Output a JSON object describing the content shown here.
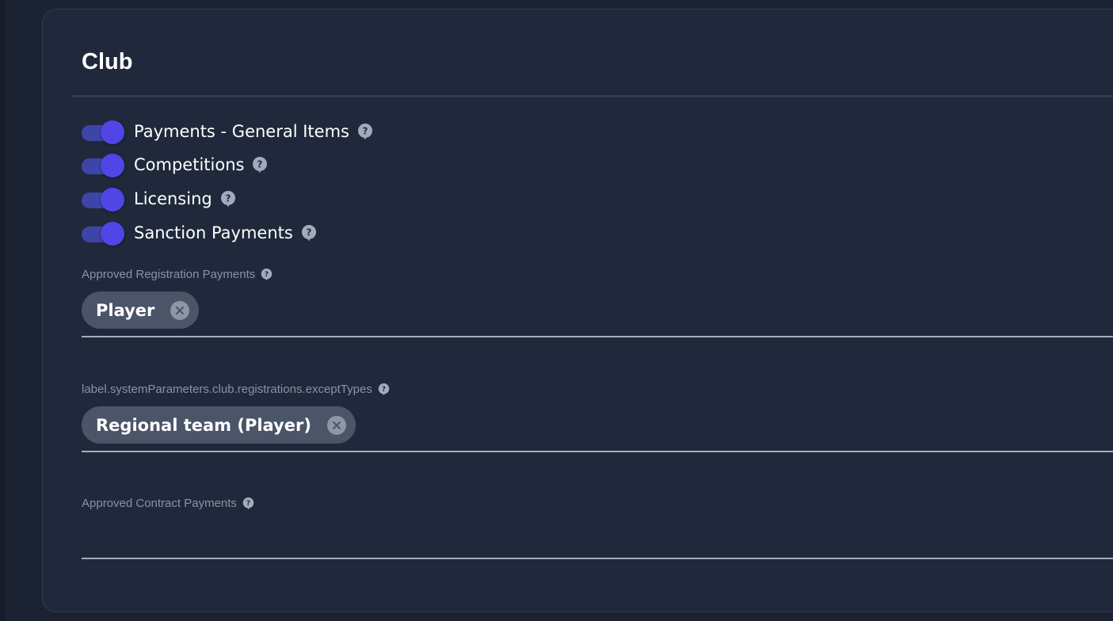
{
  "section": {
    "title": "Club"
  },
  "switches": [
    {
      "label": "Payments - General Items",
      "checked": true
    },
    {
      "label": "Competitions",
      "checked": true
    },
    {
      "label": "Licensing",
      "checked": true
    },
    {
      "label": "Sanction Payments",
      "checked": true
    }
  ],
  "fields": {
    "approved_registration_payments": {
      "label": "Approved Registration Payments",
      "chips": [
        "Player"
      ]
    },
    "except_types": {
      "label": "label.systemParameters.club.registrations.exceptTypes",
      "chips": [
        "Regional team (Player)"
      ]
    },
    "approved_contract_payments": {
      "label": "Approved Contract Payments",
      "chips": []
    }
  },
  "colors": {
    "background": "#1b2232",
    "card": "#1f293b",
    "switch_accent": "#5046e5",
    "chip": "#4a5568"
  },
  "icons": {
    "help": "help-circle-icon",
    "chip_remove": "close-circle-icon"
  }
}
